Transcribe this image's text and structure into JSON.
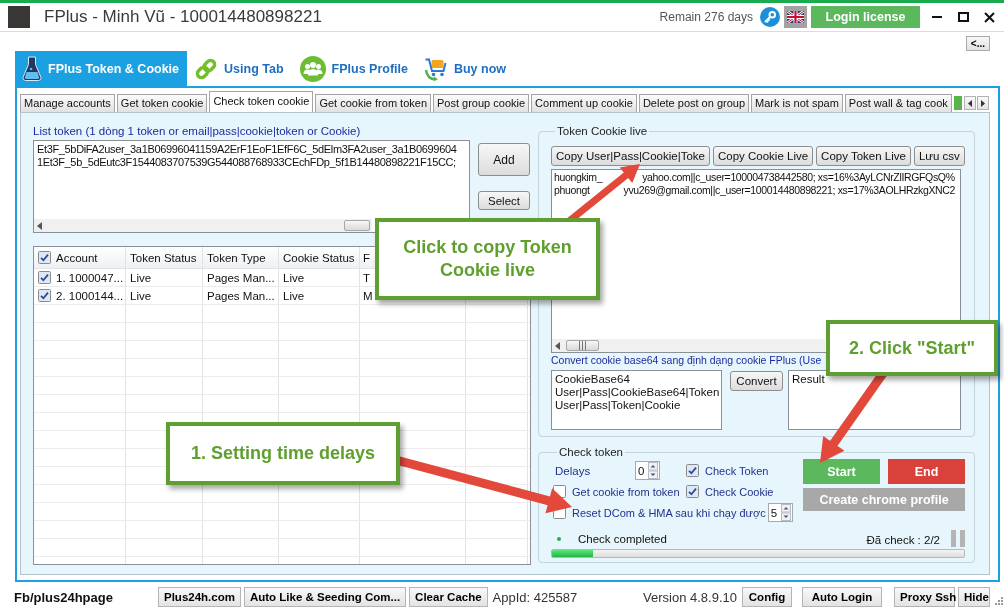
{
  "window": {
    "title": "FPlus - Minh Vũ - 100014480898221",
    "remain": "Remain 276 days",
    "login_button": "Login license",
    "back_button": "<..."
  },
  "main_tabs": [
    {
      "label": "FPlus Token & Cookie",
      "selected": true
    },
    {
      "label": "Using Tab",
      "selected": false
    },
    {
      "label": "FPlus Profile",
      "selected": false
    },
    {
      "label": "Buy now",
      "selected": false
    }
  ],
  "sub_tabs": [
    {
      "label": "Manage accounts",
      "selected": false
    },
    {
      "label": "Get token cookie",
      "selected": false
    },
    {
      "label": "Check token cookie",
      "selected": true
    },
    {
      "label": "Get cookie from token",
      "selected": false
    },
    {
      "label": "Post group cookie",
      "selected": false
    },
    {
      "label": "Comment up cookie",
      "selected": false
    },
    {
      "label": "Delete post on group",
      "selected": false
    },
    {
      "label": "Mark is not spam",
      "selected": false
    },
    {
      "label": "Post wall & tag cook",
      "selected": false
    }
  ],
  "token_list": {
    "label": "List token (1 dòng 1 token or email|pass|cookie|token or Cookie)",
    "lines": [
      "Et3F_5bDiFA2user_3a1B06996041159A2ErF1EoF1EfF6C_5dElm3FA2user_3a1B0699604",
      "1Et3F_5b_5dEutc3F1544083707539G544088768933CEchFDp_5f1B14480898221F15CC;"
    ],
    "buttons": [
      "Add",
      "Select"
    ]
  },
  "accounts_table": {
    "all_checked": true,
    "columns": [
      "Account",
      "Token Status",
      "Token Type",
      "Cookie Status",
      "F"
    ],
    "rows": [
      {
        "checked": true,
        "cells": [
          "1. 1000047...",
          "Live",
          "Pages Man...",
          "Live",
          "T"
        ]
      },
      {
        "checked": true,
        "cells": [
          "2. 1000144...",
          "Live",
          "Pages Man...",
          "Live",
          "M"
        ]
      }
    ]
  },
  "token_cookie_live": {
    "title": "Token Cookie live",
    "buttons": [
      "Copy User|Pass|Cookie|Toke",
      "Copy Cookie Live",
      "Copy Token Live",
      "Lưu csv"
    ],
    "lines": [
      {
        "parts": [
          "huongkim_",
          "yahoo.com||c_user=100004738442580; xs=16%3AyLCNrZlIRGFQsQ%"
        ]
      },
      {
        "parts": [
          "phuongt",
          "yvu269@gmail.com||c_user=100014480898221; xs=17%3AOLHRzkgXNC2"
        ]
      }
    ]
  },
  "convert": {
    "label": "Convert cookie base64 sang định dạng cookie FPlus (Use",
    "input_lines": [
      "CookieBase64",
      "User|Pass|CookieBase64|Token",
      "User|Pass|Token|Cookie"
    ],
    "button": "Convert",
    "result": "Result"
  },
  "check_token": {
    "title": "Check token",
    "delays_label": "Delays",
    "delays_value": "0",
    "options": [
      {
        "label": "Check Token",
        "checked": true
      },
      {
        "label": "Get cookie from token",
        "checked": false
      },
      {
        "label": "Check Cookie",
        "checked": true
      }
    ],
    "reset": {
      "label": "Reset DCom & HMA sau khi chạy được",
      "checked": false,
      "value": "5"
    },
    "start_button": "Start",
    "end_button": "End",
    "chrome_button": "Create chrome profile",
    "status": "Check completed",
    "count": "Đã check : 2/2",
    "progress": {
      "level": 0.1
    }
  },
  "status_bar": {
    "page": "Fb/plus24hpage",
    "left_buttons": [
      "Plus24h.com",
      "Auto Like & Seeding Com...",
      "Clear Cache"
    ],
    "app_id": "AppId: 425587",
    "version": "Version 4.8.9.10",
    "right_buttons": [
      "Config",
      "Auto Login",
      "Proxy Ssh",
      "Hide"
    ]
  },
  "callouts": [
    {
      "text": "Click to copy Token Cookie live"
    },
    {
      "text": "2. Click \"Start\""
    },
    {
      "text": "1. Setting time delays"
    }
  ]
}
